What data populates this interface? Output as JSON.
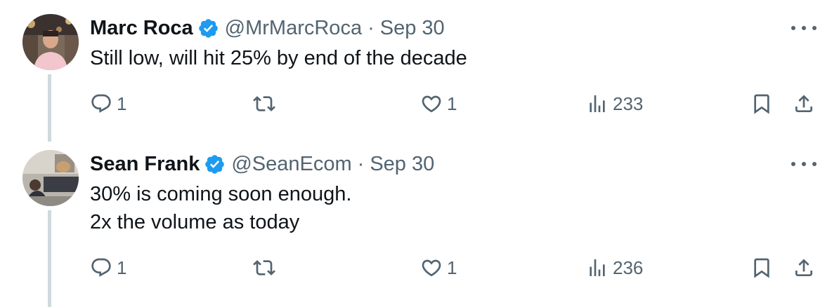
{
  "tweets": [
    {
      "author_name": "Marc Roca",
      "handle": "@MrMarcRoca",
      "separator": "·",
      "date": "Sep 30",
      "text_lines": [
        "Still low, will hit 25% by end of the decade"
      ],
      "replies": "1",
      "retweets": "",
      "likes": "1",
      "views": "233"
    },
    {
      "author_name": "Sean Frank",
      "handle": "@SeanEcom",
      "separator": "·",
      "date": "Sep 30",
      "text_lines": [
        "30% is coming soon enough.",
        "2x the volume as today"
      ],
      "replies": "1",
      "retweets": "",
      "likes": "1",
      "views": "236"
    }
  ],
  "colors": {
    "verified": "#1d9bf0",
    "secondary_text": "#536471",
    "thread_line": "#cfd9de"
  },
  "icons": [
    "verified-badge-icon",
    "more-options-icon",
    "reply-icon",
    "retweet-icon",
    "like-icon",
    "views-icon",
    "bookmark-icon",
    "share-icon"
  ]
}
